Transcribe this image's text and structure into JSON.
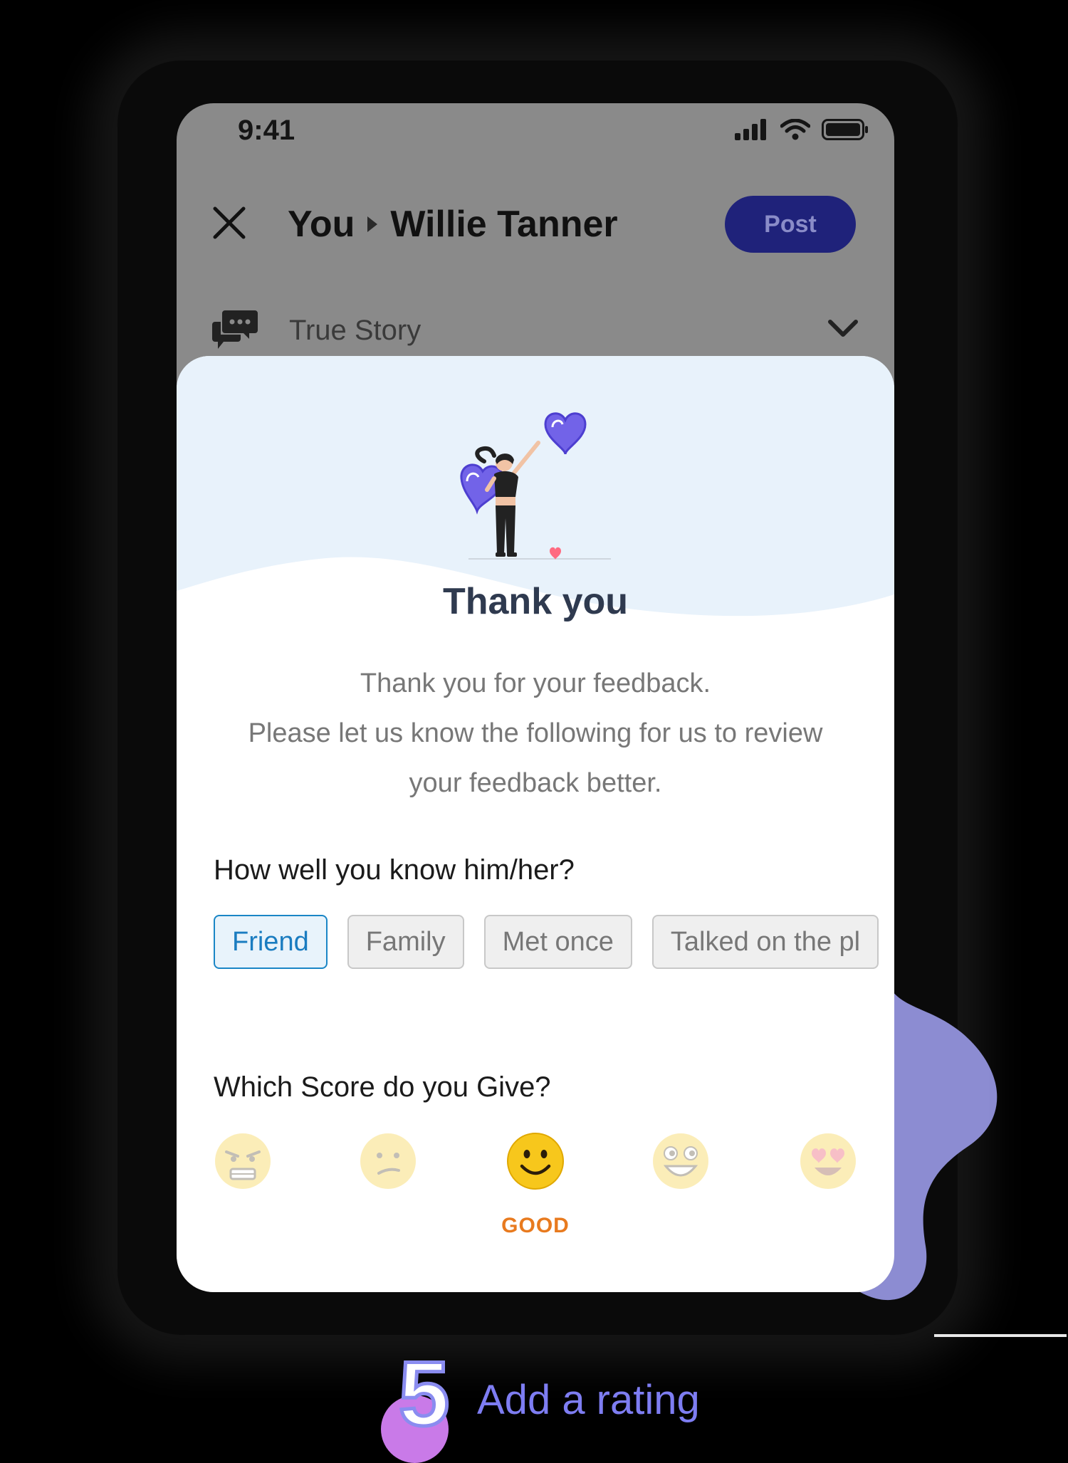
{
  "status_bar": {
    "time": "9:41"
  },
  "header": {
    "from": "You",
    "to": "Willie Tanner",
    "post_label": "Post",
    "category": "True Story"
  },
  "sheet": {
    "title": "Thank you",
    "description_line1": "Thank you for your feedback.",
    "description_line2": "Please let us know the following for us to review",
    "description_line3": "your feedback better.",
    "relationship_question": "How well you know him/her?",
    "relationship_options": [
      {
        "label": "Friend",
        "selected": true
      },
      {
        "label": "Family",
        "selected": false
      },
      {
        "label": "Met once",
        "selected": false
      },
      {
        "label": "Talked on the pl",
        "selected": false
      }
    ],
    "score_question": "Which Score do you Give?",
    "scores": [
      "angry-face-icon",
      "confused-face-icon",
      "smiling-face-icon",
      "grinning-face-icon",
      "heart-eyes-face-icon"
    ],
    "selected_score_index": 2,
    "selected_score_label": "GOOD"
  },
  "step": {
    "number": "5",
    "label": "Add a rating"
  },
  "colors": {
    "primary": "#1f227a",
    "chip_selected": "#1a86c6",
    "rating_label": "#e87a1e",
    "accent": "#7e7df2"
  }
}
